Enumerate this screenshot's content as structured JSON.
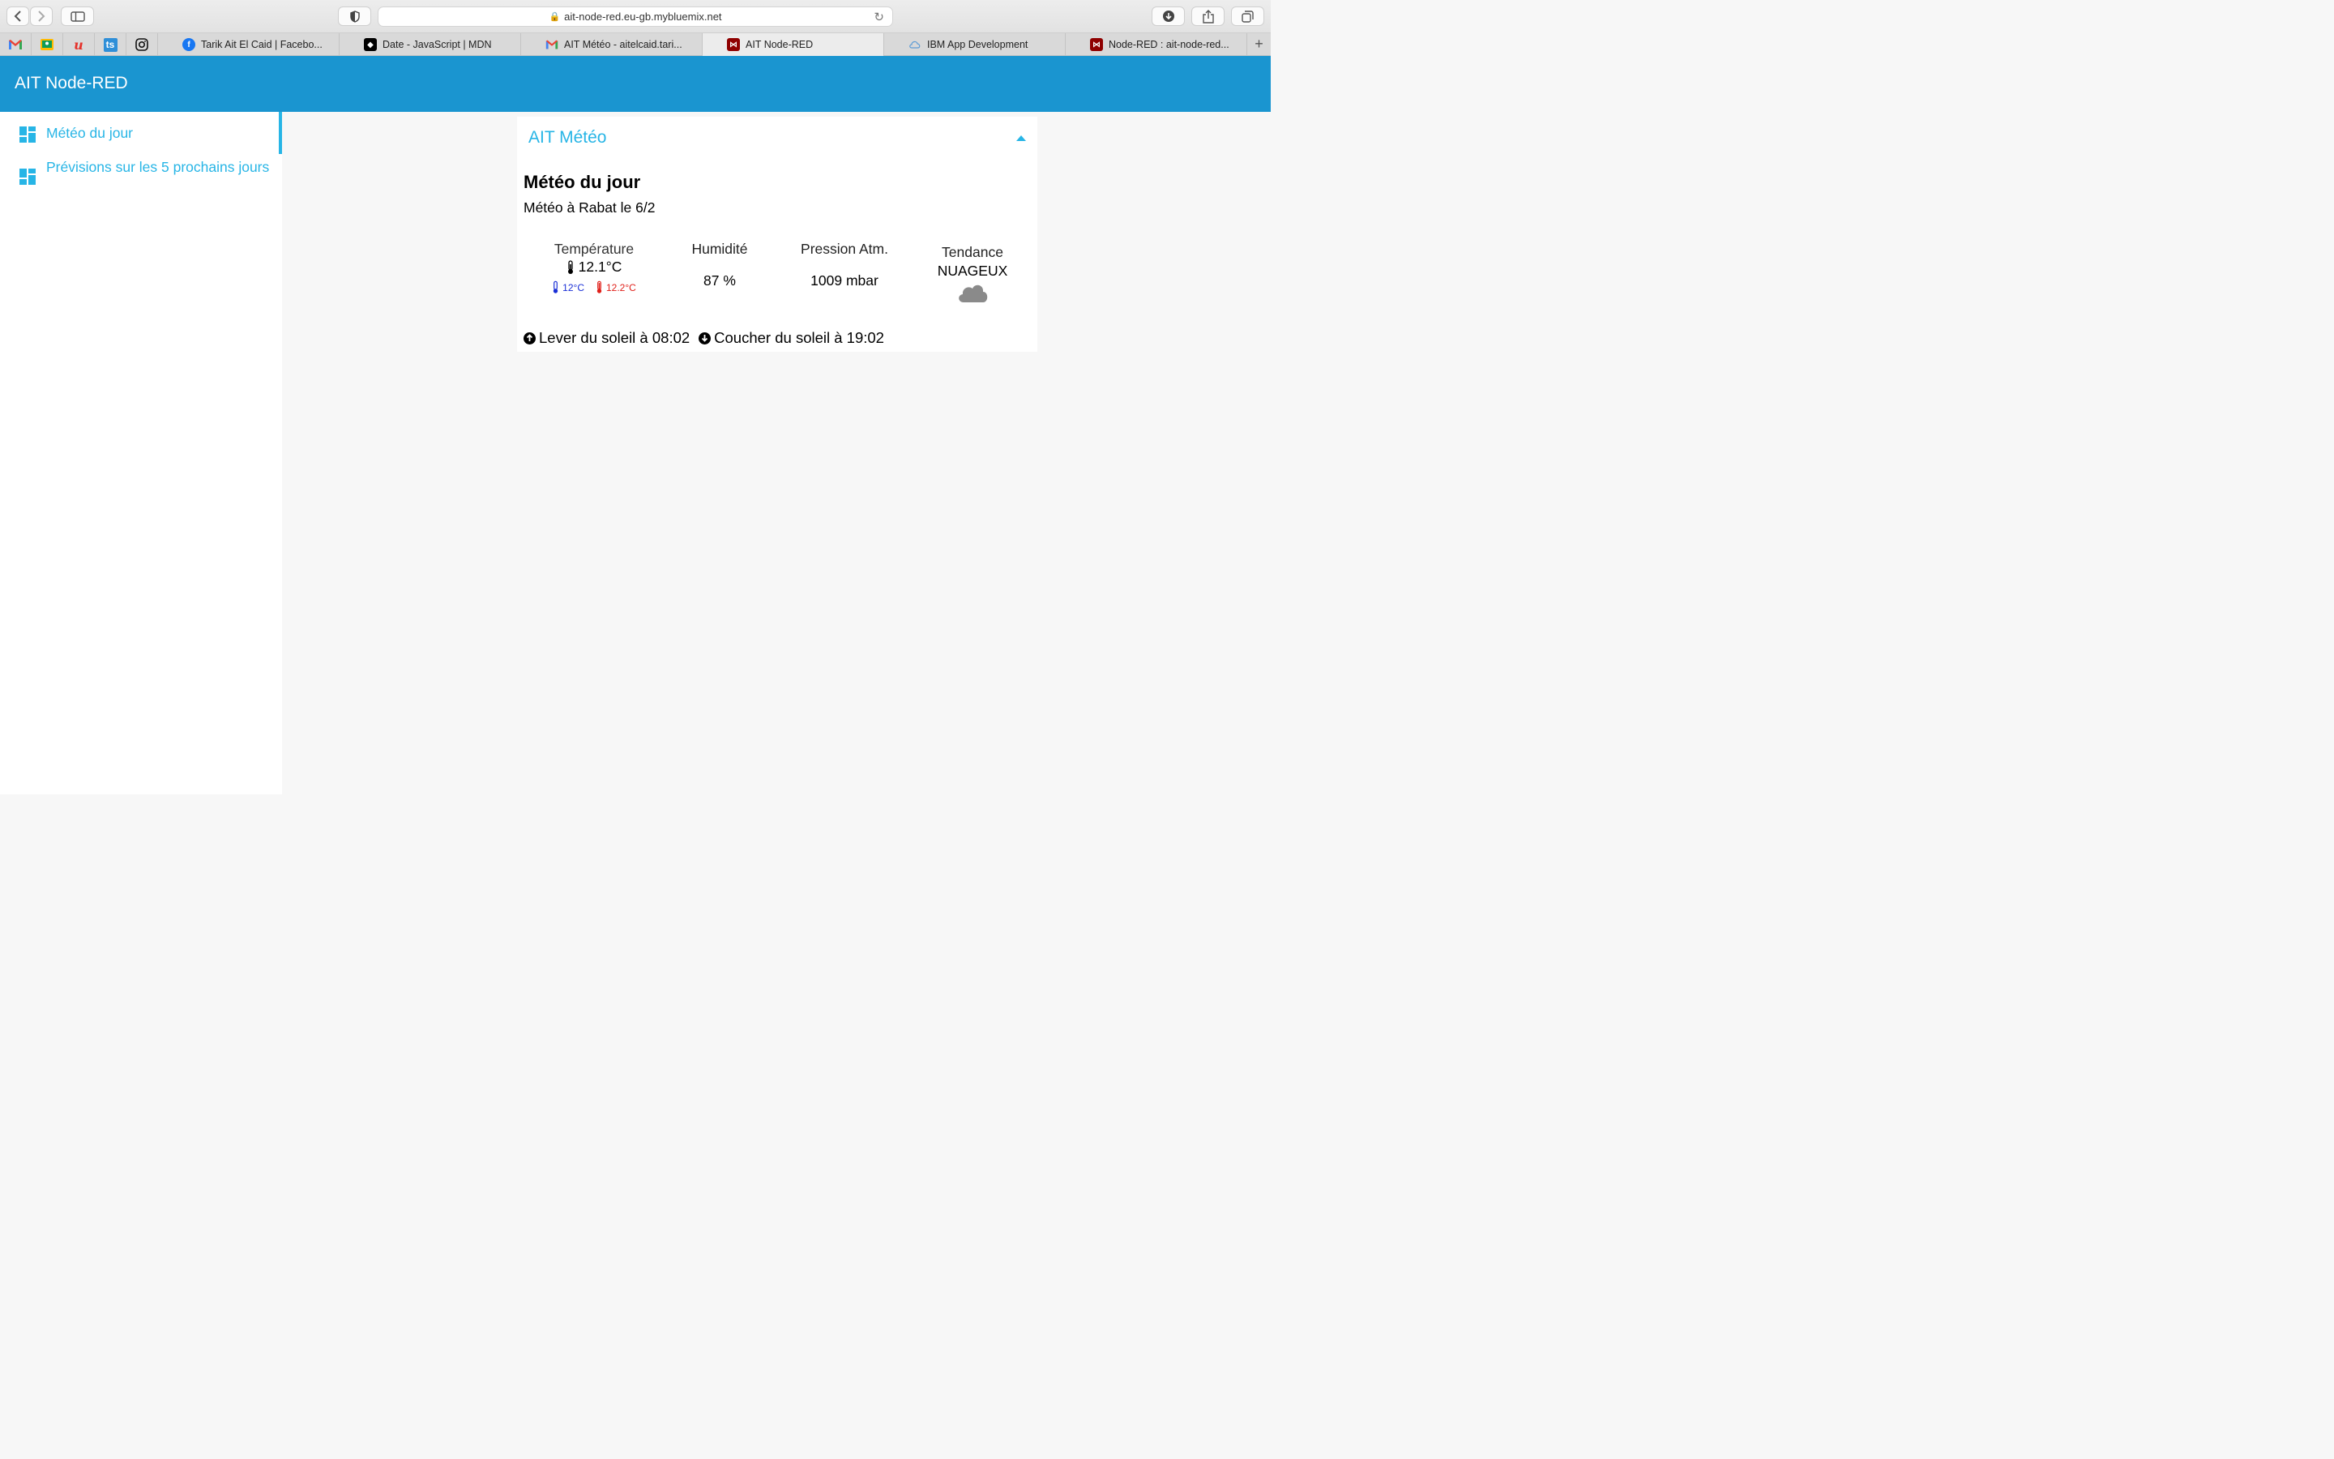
{
  "browser": {
    "url": "ait-node-red.eu-gb.mybluemix.net",
    "pinned_tabs": [
      "gmail-icon",
      "classroom-icon",
      "u-icon",
      "ts-icon",
      "instagram-icon"
    ],
    "tabs": [
      {
        "label": "Tarik Ait El Caid | Facebo...",
        "icon": "facebook-icon",
        "color": "#1877f2",
        "glyph": "f"
      },
      {
        "label": "Date - JavaScript | MDN",
        "icon": "mdn-icon",
        "color": "#000000",
        "glyph": "◆"
      },
      {
        "label": "AIT Météo - aitelcaid.tari...",
        "icon": "gmail-icon",
        "color": "#ffffff",
        "glyph": "M"
      },
      {
        "label": "AIT Node-RED",
        "icon": "node-red-icon",
        "color": "#8f0000",
        "glyph": "⋈",
        "active": true
      },
      {
        "label": "IBM App Development",
        "icon": "ibm-cloud-icon",
        "color": "#d9d9d9",
        "glyph": "☁"
      },
      {
        "label": "Node-RED : ait-node-red...",
        "icon": "node-red-icon",
        "color": "#8f0000",
        "glyph": "⋈"
      }
    ]
  },
  "app": {
    "title": "AIT Node-RED",
    "accent": "#1a95d0",
    "link_color": "#27b5e6"
  },
  "sidebar": {
    "items": [
      {
        "label": "Météo du jour",
        "active": true
      },
      {
        "label": "Prévisions sur les 5 prochains jours"
      }
    ]
  },
  "card": {
    "group_title": "AIT Météo",
    "heading": "Météo du jour",
    "subheading": "Météo à Rabat le 6/2",
    "temperature": {
      "label": "Température",
      "value": "12.1°C",
      "min": "12°C",
      "max": "12.2°C"
    },
    "humidity": {
      "label": "Humidité",
      "value": "87 %"
    },
    "pressure": {
      "label": "Pression Atm.",
      "value": "1009 mbar"
    },
    "trend": {
      "label": "Tendance",
      "value": "NUAGEUX",
      "icon": "cloud-icon"
    },
    "sunrise": "Lever du soleil à 08:02",
    "sunset": "Coucher du soleil à 19:02"
  }
}
